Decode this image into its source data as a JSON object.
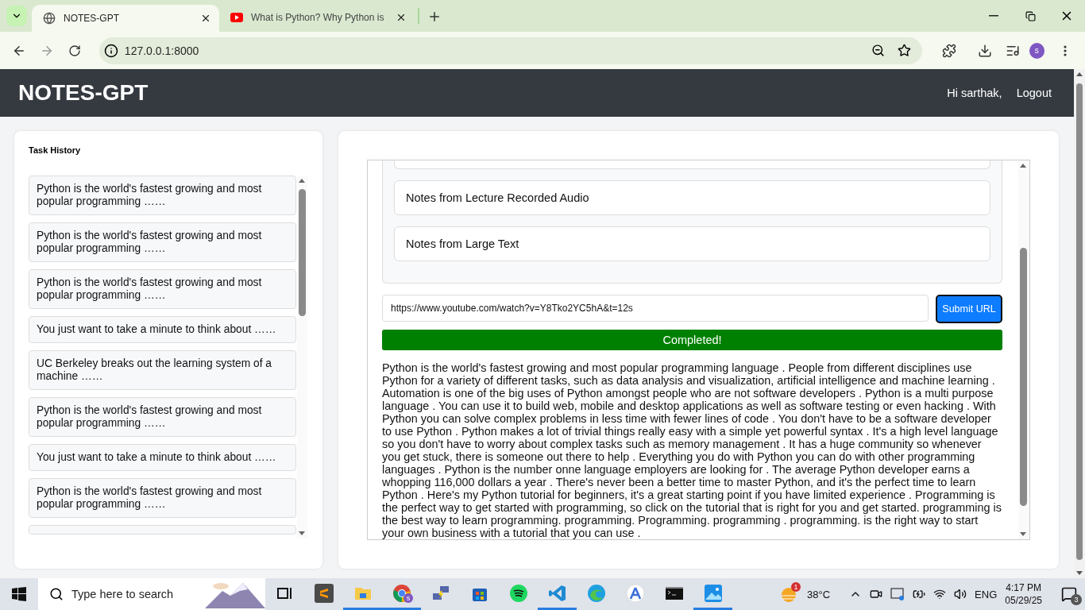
{
  "browser": {
    "tabs": [
      {
        "title": "NOTES-GPT",
        "selected": true,
        "kind": "globe"
      },
      {
        "title": "What is Python? Why Python is",
        "selected": false,
        "kind": "video"
      }
    ],
    "address": "127.0.0.1:8000",
    "profile_initial": "s"
  },
  "header": {
    "brand": "NOTES-GPT",
    "greeting": "Hi sarthak,",
    "logout": "Logout"
  },
  "task_history": {
    "title": "Task History",
    "items": [
      {
        "text": "Python is the world's fastest growing and most popular programming ……"
      },
      {
        "text": "Python is the world's fastest growing and most popular programming ……"
      },
      {
        "text": "Python is the world's fastest growing and most popular programming ……"
      },
      {
        "text": "You just want to take a minute to think about ……"
      },
      {
        "text": "UC Berkeley breaks out the learning system of a machine ……"
      },
      {
        "text": "Python is the world's fastest growing and most popular programming ……"
      },
      {
        "text": "You just want to take a minute to think about ……"
      },
      {
        "text": "Python is the world's fastest growing and most popular programming ……"
      }
    ]
  },
  "options": [
    {
      "label": "Notes from Lecture Recorded Audio"
    },
    {
      "label": "Notes from Large Text"
    }
  ],
  "url_field": {
    "value": "https://www.youtube.com/watch?v=Y8Tko2YC5hA&t=12s"
  },
  "submit": "Submit URL",
  "progress": {
    "text": "Completed!",
    "level": 1
  },
  "notes": "Python is the world's fastest growing and most popular programming language . People from different disciplines use Python for a variety of different tasks, such as data analysis and visualization, artificial intelligence and machine learning . Automation is one of the big uses of Python amongst people who are not software developers . Python is a multi purpose language . You can use it to build web, mobile and desktop applications as well as software testing or even hacking . With Python you can solve complex problems in less time with fewer lines of code . You don't have to be a software developer to use Python . Python makes a lot of trivial things really easy with a simple yet powerful syntax . It's a high level language so you don't have to worry about complex tasks such as memory management . It has a huge community so whenever you get stuck, there is someone out there to help . Everything you do with Python you can do with other programming languages . Python is the number onne language employers are looking for . The average Python developer earns a whopping 116,000 dollars a year . There's never been a better time to master Python, and it's the perfect time to learn Python . Here's my Python tutorial for beginners, it's a great starting point if you have limited experience . Programming is the perfect way to get started with programming, so click on the tutorial that is right for you and get started. programming is the best way to learn programming. programming. Programming. programming . programming. is the right way to start your own business with a tutorial that you can use .",
  "taskbar": {
    "search_placeholder": "Type here to search",
    "chrome_badge": "s",
    "apps": [
      {
        "kind": "taskview",
        "active": false
      },
      {
        "kind": "sublime",
        "active": false
      },
      {
        "kind": "folder",
        "active": true
      },
      {
        "kind": "chrome",
        "active": true
      },
      {
        "kind": "network",
        "active": false
      },
      {
        "kind": "store",
        "active": false
      },
      {
        "kind": "spotify",
        "active": false
      },
      {
        "kind": "vscode",
        "active": true
      },
      {
        "kind": "edge",
        "active": false
      },
      {
        "kind": "android",
        "active": false
      },
      {
        "kind": "terminal",
        "active": false
      },
      {
        "kind": "photos",
        "active": true
      }
    ],
    "weather_badge": "1",
    "temperature": "38°C",
    "language": "ENG",
    "time": "4:17 PM",
    "date": "05/29/25",
    "notifications": "3"
  }
}
